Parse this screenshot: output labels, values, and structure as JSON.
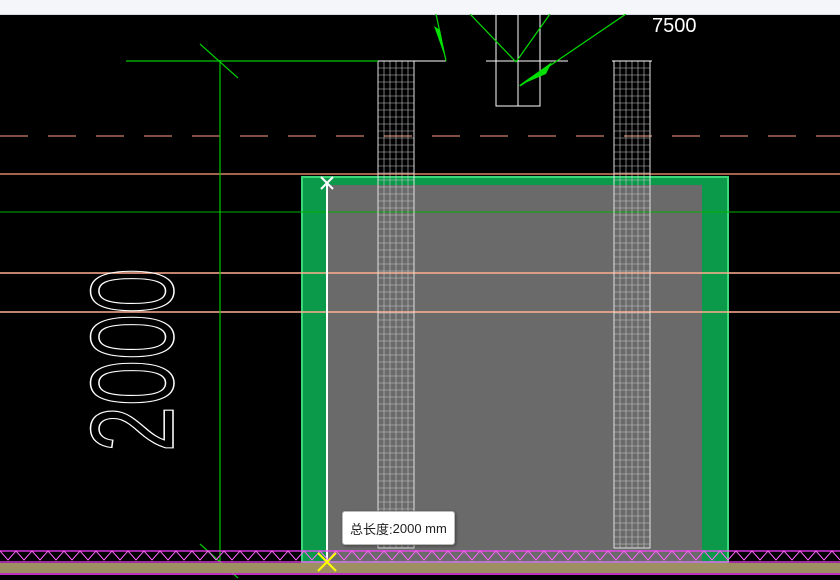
{
  "window": {
    "header_strip": ""
  },
  "drawing": {
    "dimension_top": "7500",
    "dimension_left": "2000"
  },
  "tooltip": {
    "label": "总长度:",
    "value": "2000 mm"
  },
  "colors": {
    "background": "#000000",
    "extension_line": "#00c800",
    "wall_fill": "#0a9a4a",
    "wall_border": "#2fd070",
    "room_fill": "#6a6a6a",
    "grid_line": "#ffb090",
    "hatch": "#c8c8c8",
    "boundary": "#ff40ff",
    "dimension_text": "#ffffff"
  },
  "icons": [
    "measure-start-x-icon",
    "snap-marker-icon",
    "leader-arrow-icon"
  ]
}
